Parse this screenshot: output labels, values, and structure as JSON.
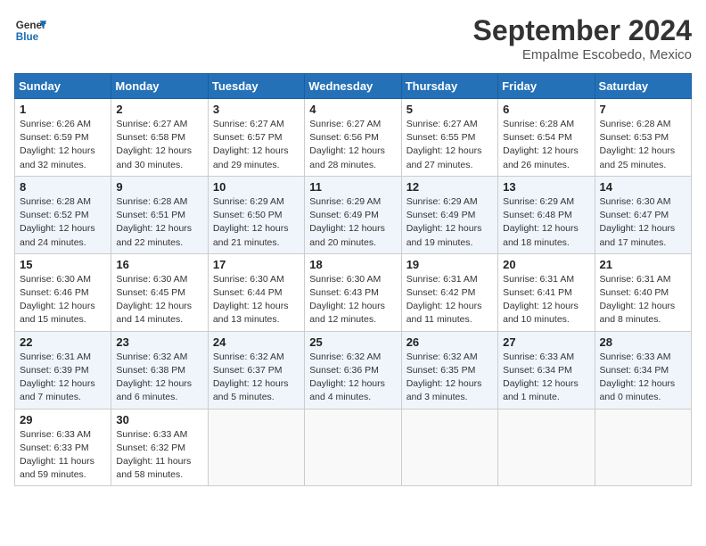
{
  "header": {
    "logo_line1": "General",
    "logo_line2": "Blue",
    "month": "September 2024",
    "location": "Empalme Escobedo, Mexico"
  },
  "weekdays": [
    "Sunday",
    "Monday",
    "Tuesday",
    "Wednesday",
    "Thursday",
    "Friday",
    "Saturday"
  ],
  "weeks": [
    [
      {
        "day": "1",
        "info": "Sunrise: 6:26 AM\nSunset: 6:59 PM\nDaylight: 12 hours\nand 32 minutes."
      },
      {
        "day": "2",
        "info": "Sunrise: 6:27 AM\nSunset: 6:58 PM\nDaylight: 12 hours\nand 30 minutes."
      },
      {
        "day": "3",
        "info": "Sunrise: 6:27 AM\nSunset: 6:57 PM\nDaylight: 12 hours\nand 29 minutes."
      },
      {
        "day": "4",
        "info": "Sunrise: 6:27 AM\nSunset: 6:56 PM\nDaylight: 12 hours\nand 28 minutes."
      },
      {
        "day": "5",
        "info": "Sunrise: 6:27 AM\nSunset: 6:55 PM\nDaylight: 12 hours\nand 27 minutes."
      },
      {
        "day": "6",
        "info": "Sunrise: 6:28 AM\nSunset: 6:54 PM\nDaylight: 12 hours\nand 26 minutes."
      },
      {
        "day": "7",
        "info": "Sunrise: 6:28 AM\nSunset: 6:53 PM\nDaylight: 12 hours\nand 25 minutes."
      }
    ],
    [
      {
        "day": "8",
        "info": "Sunrise: 6:28 AM\nSunset: 6:52 PM\nDaylight: 12 hours\nand 24 minutes."
      },
      {
        "day": "9",
        "info": "Sunrise: 6:28 AM\nSunset: 6:51 PM\nDaylight: 12 hours\nand 22 minutes."
      },
      {
        "day": "10",
        "info": "Sunrise: 6:29 AM\nSunset: 6:50 PM\nDaylight: 12 hours\nand 21 minutes."
      },
      {
        "day": "11",
        "info": "Sunrise: 6:29 AM\nSunset: 6:49 PM\nDaylight: 12 hours\nand 20 minutes."
      },
      {
        "day": "12",
        "info": "Sunrise: 6:29 AM\nSunset: 6:49 PM\nDaylight: 12 hours\nand 19 minutes."
      },
      {
        "day": "13",
        "info": "Sunrise: 6:29 AM\nSunset: 6:48 PM\nDaylight: 12 hours\nand 18 minutes."
      },
      {
        "day": "14",
        "info": "Sunrise: 6:30 AM\nSunset: 6:47 PM\nDaylight: 12 hours\nand 17 minutes."
      }
    ],
    [
      {
        "day": "15",
        "info": "Sunrise: 6:30 AM\nSunset: 6:46 PM\nDaylight: 12 hours\nand 15 minutes."
      },
      {
        "day": "16",
        "info": "Sunrise: 6:30 AM\nSunset: 6:45 PM\nDaylight: 12 hours\nand 14 minutes."
      },
      {
        "day": "17",
        "info": "Sunrise: 6:30 AM\nSunset: 6:44 PM\nDaylight: 12 hours\nand 13 minutes."
      },
      {
        "day": "18",
        "info": "Sunrise: 6:30 AM\nSunset: 6:43 PM\nDaylight: 12 hours\nand 12 minutes."
      },
      {
        "day": "19",
        "info": "Sunrise: 6:31 AM\nSunset: 6:42 PM\nDaylight: 12 hours\nand 11 minutes."
      },
      {
        "day": "20",
        "info": "Sunrise: 6:31 AM\nSunset: 6:41 PM\nDaylight: 12 hours\nand 10 minutes."
      },
      {
        "day": "21",
        "info": "Sunrise: 6:31 AM\nSunset: 6:40 PM\nDaylight: 12 hours\nand 8 minutes."
      }
    ],
    [
      {
        "day": "22",
        "info": "Sunrise: 6:31 AM\nSunset: 6:39 PM\nDaylight: 12 hours\nand 7 minutes."
      },
      {
        "day": "23",
        "info": "Sunrise: 6:32 AM\nSunset: 6:38 PM\nDaylight: 12 hours\nand 6 minutes."
      },
      {
        "day": "24",
        "info": "Sunrise: 6:32 AM\nSunset: 6:37 PM\nDaylight: 12 hours\nand 5 minutes."
      },
      {
        "day": "25",
        "info": "Sunrise: 6:32 AM\nSunset: 6:36 PM\nDaylight: 12 hours\nand 4 minutes."
      },
      {
        "day": "26",
        "info": "Sunrise: 6:32 AM\nSunset: 6:35 PM\nDaylight: 12 hours\nand 3 minutes."
      },
      {
        "day": "27",
        "info": "Sunrise: 6:33 AM\nSunset: 6:34 PM\nDaylight: 12 hours\nand 1 minute."
      },
      {
        "day": "28",
        "info": "Sunrise: 6:33 AM\nSunset: 6:34 PM\nDaylight: 12 hours\nand 0 minutes."
      }
    ],
    [
      {
        "day": "29",
        "info": "Sunrise: 6:33 AM\nSunset: 6:33 PM\nDaylight: 11 hours\nand 59 minutes."
      },
      {
        "day": "30",
        "info": "Sunrise: 6:33 AM\nSunset: 6:32 PM\nDaylight: 11 hours\nand 58 minutes."
      },
      {
        "day": "",
        "info": ""
      },
      {
        "day": "",
        "info": ""
      },
      {
        "day": "",
        "info": ""
      },
      {
        "day": "",
        "info": ""
      },
      {
        "day": "",
        "info": ""
      }
    ]
  ]
}
